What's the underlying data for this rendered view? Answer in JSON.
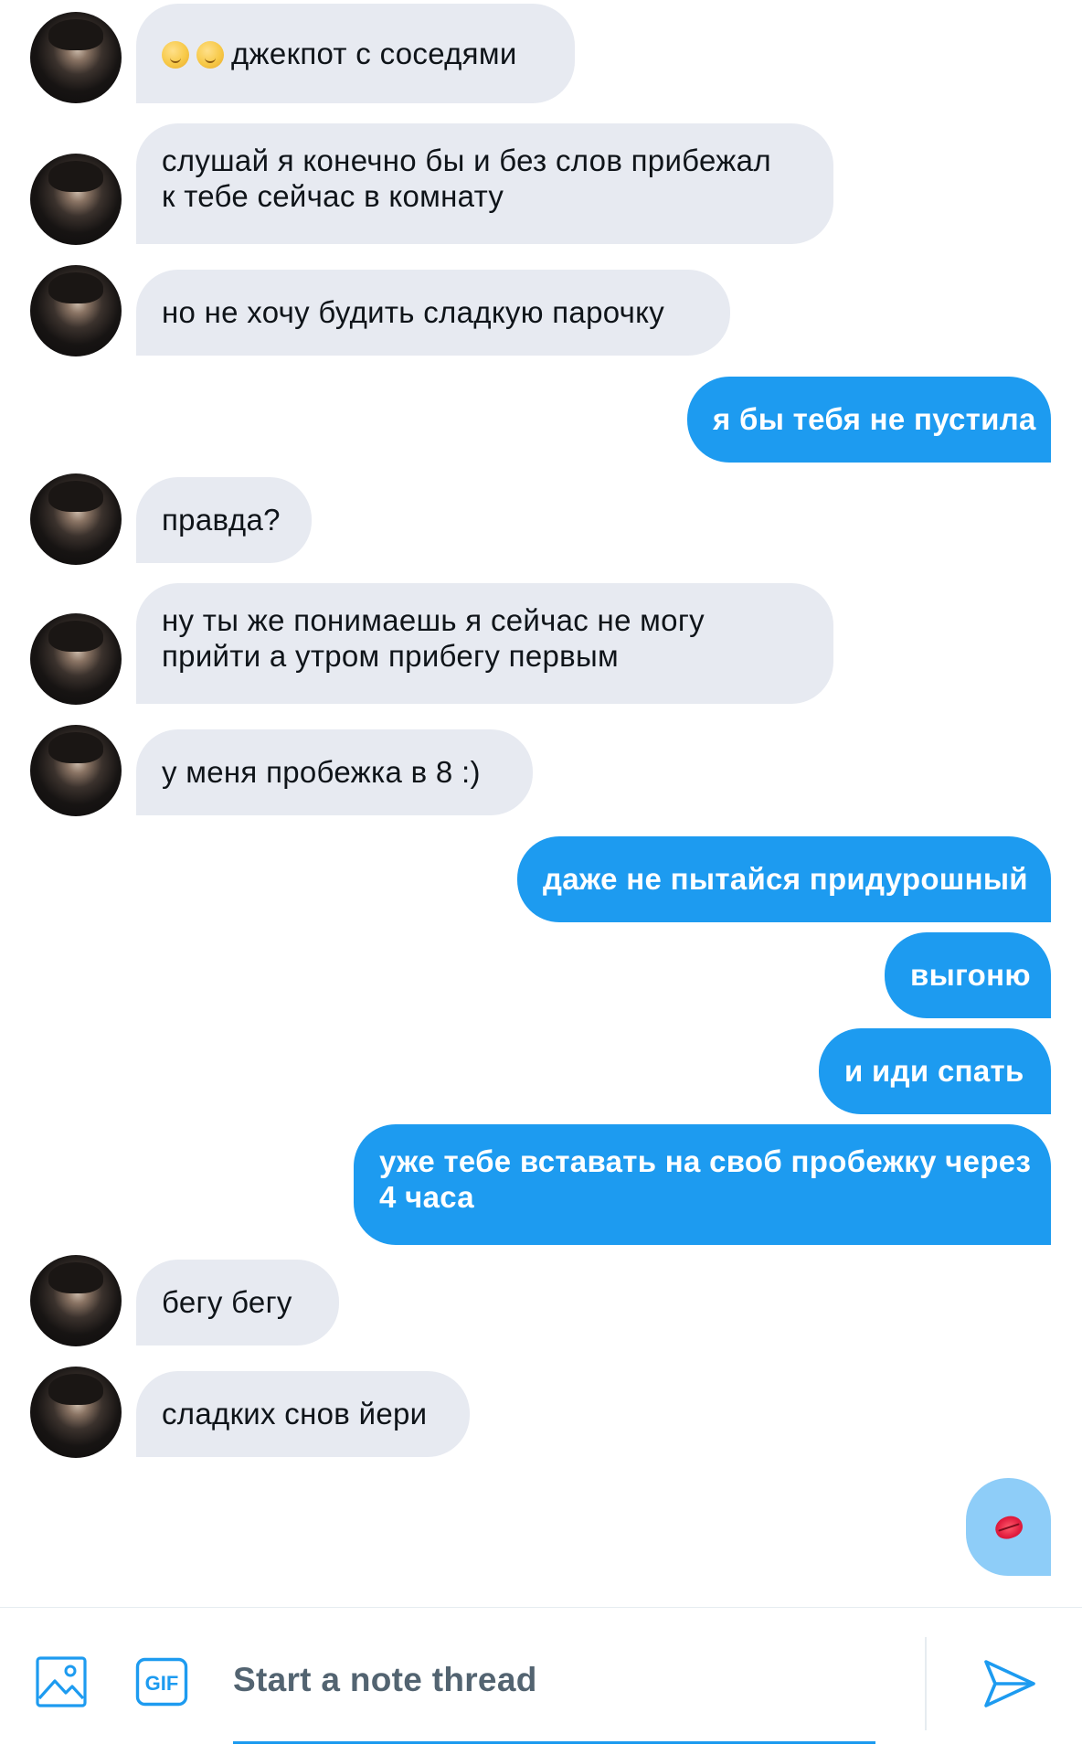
{
  "messages": [
    {
      "side": "in",
      "emoji_prefix": 2,
      "text": "джекпот с соседями"
    },
    {
      "side": "in",
      "lines": [
        "слушай я конечно бы и без слов прибежал",
        "к тебе сейчас в комнату"
      ]
    },
    {
      "side": "in",
      "text": "но не хочу будить сладкую парочку"
    },
    {
      "side": "out",
      "text": "я бы тебя не пустила"
    },
    {
      "side": "in",
      "text": "правда?"
    },
    {
      "side": "in",
      "lines": [
        "ну ты же понимаешь я сейчас не могу",
        "прийти а утром прибегу первым"
      ]
    },
    {
      "side": "in",
      "text": "у меня пробежка в 8 :)"
    },
    {
      "side": "out",
      "text": "даже не пытайся придурошный"
    },
    {
      "side": "out",
      "text": "выгоню"
    },
    {
      "side": "out",
      "text": "и иди спать"
    },
    {
      "side": "out",
      "lines": [
        "уже тебе вставать на своб пробежку через",
        "4 часа"
      ]
    },
    {
      "side": "in",
      "text": "бегу бегу"
    },
    {
      "side": "in",
      "text": "сладких снов йери"
    },
    {
      "side": "out",
      "emoji": "kiss-mark"
    }
  ],
  "composer": {
    "placeholder": "Start a note thread",
    "gif_label": "GIF",
    "icons": [
      "image-icon",
      "gif-icon",
      "send-icon"
    ]
  },
  "colors": {
    "outgoing_bubble": "#1d9bf0",
    "outgoing_emoji_bubble": "#8ecdf8",
    "incoming_bubble": "#e7eaf1",
    "accent": "#1d9bf0"
  }
}
